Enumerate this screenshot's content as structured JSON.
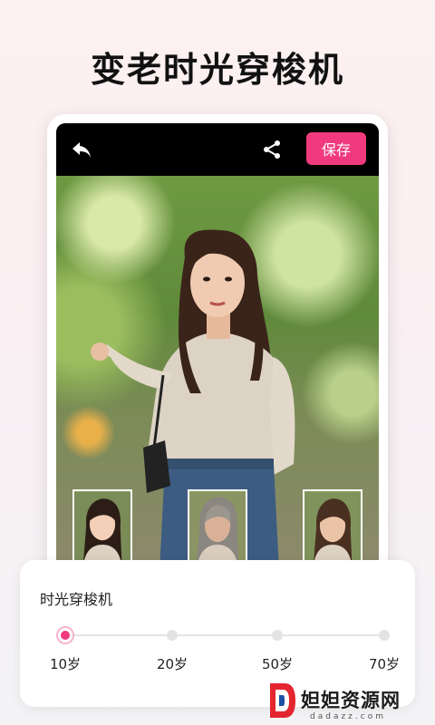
{
  "headline": "变老时光穿梭机",
  "toolbar": {
    "back_icon": "back-arrow-icon",
    "share_icon": "share-icon",
    "save_label": "保存",
    "accent_color": "#f13a7e"
  },
  "preview": {
    "thumbnails": [
      "young-face-thumbnail",
      "old-face-thumbnail",
      "middle-age-face-thumbnail"
    ]
  },
  "panel": {
    "title": "时光穿梭机",
    "ages": [
      "10岁",
      "20岁",
      "50岁",
      "70岁"
    ],
    "selected_index": 0
  },
  "watermark": {
    "name": "妲妲资源网",
    "url": "dadazz.com"
  }
}
